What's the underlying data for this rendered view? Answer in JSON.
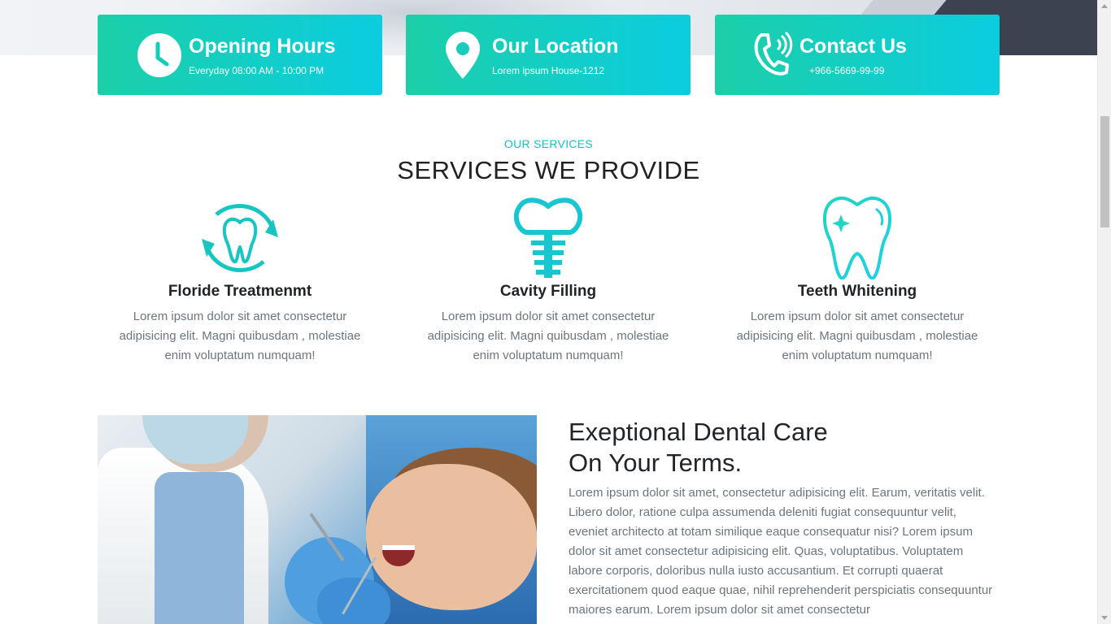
{
  "info_cards": [
    {
      "title": "Opening Hours",
      "subtitle": "Everyday 08:00 AM - 10:00 PM",
      "icon": "clock-icon"
    },
    {
      "title": "Our Location",
      "subtitle": "Lorem ipsum House-1212",
      "icon": "location-pin-icon"
    },
    {
      "title": "Contact Us",
      "subtitle": "+966-5669-99-99",
      "icon": "phone-icon"
    }
  ],
  "services": {
    "eyebrow": "OUR SERVICES",
    "title": "SERVICES WE PROVIDE",
    "items": [
      {
        "name": "Floride Treatmenmt",
        "description": "Lorem ipsum dolor sit amet consectetur adipisicing elit. Magni quibusdam , molestiae enim voluptatum numquam!",
        "icon": "tooth-cycle-icon"
      },
      {
        "name": "Cavity Filling",
        "description": "Lorem ipsum dolor sit amet consectetur adipisicing elit. Magni quibusdam , molestiae enim voluptatum numquam!",
        "icon": "dental-implant-icon"
      },
      {
        "name": "Teeth Whitening",
        "description": "Lorem ipsum dolor sit amet consectetur adipisicing elit. Magni quibusdam , molestiae enim voluptatum numquam!",
        "icon": "sparkling-tooth-icon"
      }
    ]
  },
  "care": {
    "title_line1": "Exeptional Dental Care",
    "title_line2": "On Your Terms.",
    "body": "Lorem ipsum dolor sit amet, consectetur adipisicing elit. Earum, veritatis velit. Libero dolor, ratione culpa assumenda deleniti fugiat consequuntur velit, eveniet architecto at totam similique eaque consequatur nisi? Lorem ipsum dolor sit amet consectetur adipisicing elit. Quas, voluptatibus. Voluptatem labore corporis, doloribus nulla iusto accusantium. Et corrupti quaerat exercitationem quod eaque quae, nihil reprehenderit perspiciatis consequuntur maiores earum. Lorem ipsum dolor sit amet consectetur"
  },
  "colors": {
    "accent": "#17c0c4",
    "card_gradient_start": "#1ccfa8",
    "card_gradient_end": "#0bcde0"
  }
}
